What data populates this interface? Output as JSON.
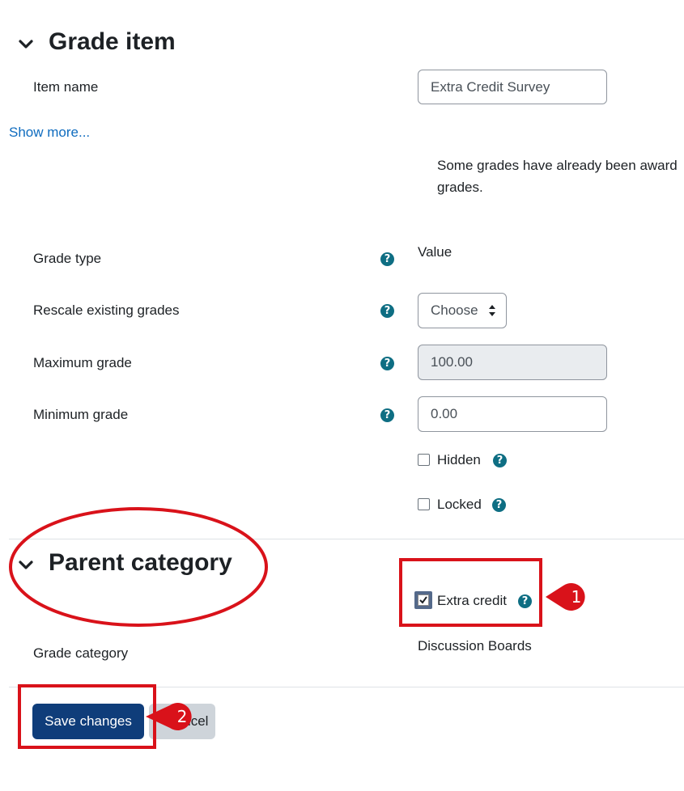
{
  "grade_item": {
    "heading": "Grade item",
    "item_name_label": "Item name",
    "item_name_value": "Extra Credit Survey",
    "show_more": "Show more...",
    "notice_line1": "Some grades have already been award",
    "notice_line2": "grades.",
    "grade_type_label": "Grade type",
    "grade_type_value": "Value",
    "rescale_label": "Rescale existing grades",
    "rescale_value": "Choose",
    "max_grade_label": "Maximum grade",
    "max_grade_value": "100.00",
    "min_grade_label": "Minimum grade",
    "min_grade_value": "0.00",
    "hidden_label": "Hidden",
    "locked_label": "Locked"
  },
  "parent_category": {
    "heading": "Parent category",
    "extra_credit_label": "Extra credit",
    "extra_credit_checked": true,
    "grade_category_label": "Grade category",
    "grade_category_value": "Discussion Boards"
  },
  "buttons": {
    "save_label": "Save changes",
    "cancel_label": "Cancel"
  },
  "help_glyph": "?",
  "annotations": {
    "marker1": "1",
    "marker2": "2",
    "color": "#d9121a"
  }
}
